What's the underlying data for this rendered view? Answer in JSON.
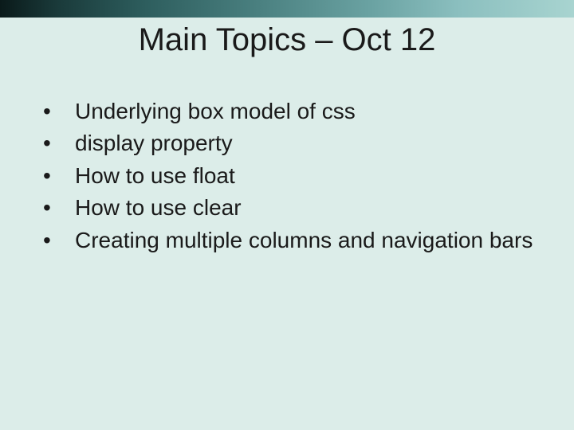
{
  "slide": {
    "title": "Main Topics – Oct 12",
    "bullets": [
      "Underlying box model of css",
      "display  property",
      "How to use float",
      "How to use clear",
      "Creating multiple columns and navigation bars"
    ]
  }
}
